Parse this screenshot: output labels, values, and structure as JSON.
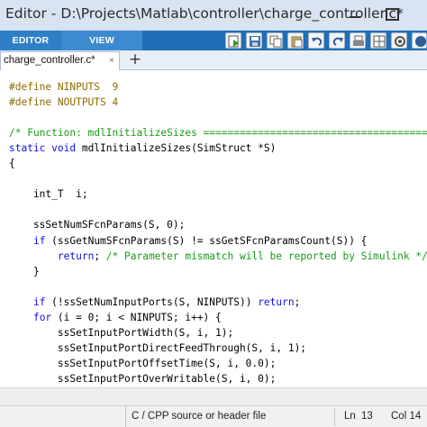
{
  "window": {
    "title": "Editor - D:\\Projects\\Matlab\\controller\\charge_controller.c*"
  },
  "toolstrip": {
    "tabs": [
      {
        "label": "EDITOR"
      },
      {
        "label": "VIEW"
      }
    ],
    "quick_access_icons": [
      "run-section-icon",
      "save-icon",
      "copy-icon",
      "paste-icon",
      "undo-icon",
      "redo-icon",
      "print-icon",
      "layout-icon",
      "settings-icon"
    ]
  },
  "document_tabs": {
    "active": "charge_controller.c*",
    "close_glyph": "×",
    "add_glyph": "+"
  },
  "code_lines": [
    [
      {
        "t": "#define NINPUTS  9",
        "c": "pp"
      }
    ],
    [
      {
        "t": "#define NOUTPUTS 4",
        "c": "pp"
      }
    ],
    [],
    [
      {
        "t": "/* Function: mdlInitializeSizes ==================================================",
        "c": "cm"
      }
    ],
    [
      {
        "t": "static void ",
        "c": "kw"
      },
      {
        "t": "mdlInitializeSizes(SimStruct *S)",
        "c": "tx"
      }
    ],
    [
      {
        "t": "{",
        "c": "tx"
      }
    ],
    [],
    [
      {
        "t": "    int_T  i;",
        "c": "tx"
      }
    ],
    [],
    [
      {
        "t": "    ssSetNumSFcnParams(S, 0);",
        "c": "tx"
      }
    ],
    [
      {
        "t": "    ",
        "c": "tx"
      },
      {
        "t": "if",
        "c": "kw"
      },
      {
        "t": " (ssGetNumSFcnParams(S) != ssGetSFcnParamsCount(S)) {",
        "c": "tx"
      }
    ],
    [
      {
        "t": "        ",
        "c": "tx"
      },
      {
        "t": "return",
        "c": "kw"
      },
      {
        "t": "; ",
        "c": "tx"
      },
      {
        "t": "/* Parameter mismatch will be reported by Simulink */",
        "c": "cm"
      }
    ],
    [
      {
        "t": "    }",
        "c": "tx"
      }
    ],
    [],
    [
      {
        "t": "    ",
        "c": "tx"
      },
      {
        "t": "if",
        "c": "kw"
      },
      {
        "t": " (!ssSetNumInputPorts(S, NINPUTS)) ",
        "c": "tx"
      },
      {
        "t": "return",
        "c": "kw"
      },
      {
        "t": ";",
        "c": "tx"
      }
    ],
    [
      {
        "t": "    ",
        "c": "tx"
      },
      {
        "t": "for",
        "c": "kw"
      },
      {
        "t": " (i = 0; i < NINPUTS; i++) {",
        "c": "tx"
      }
    ],
    [
      {
        "t": "        ssSetInputPortWidth(S, i, 1);",
        "c": "tx"
      }
    ],
    [
      {
        "t": "        ssSetInputPortDirectFeedThrough(S, i, 1);",
        "c": "tx"
      }
    ],
    [
      {
        "t": "        ssSetInputPortOffsetTime(S, i, 0.0);",
        "c": "tx"
      }
    ],
    [
      {
        "t": "        ssSetInputPortOverWritable(S, i, 0);",
        "c": "tx"
      }
    ],
    [
      {
        "t": "    }",
        "c": "tx"
      }
    ]
  ],
  "status": {
    "file_type": "C / CPP source or header file",
    "ln_label": "Ln",
    "ln_value": "13",
    "col_label": "Col  14"
  },
  "colors": {
    "keyword": "#1010e0",
    "comment": "#1a9a1a",
    "preprocessor": "#8f6a00",
    "toolstrip": "#1f6fb6"
  }
}
